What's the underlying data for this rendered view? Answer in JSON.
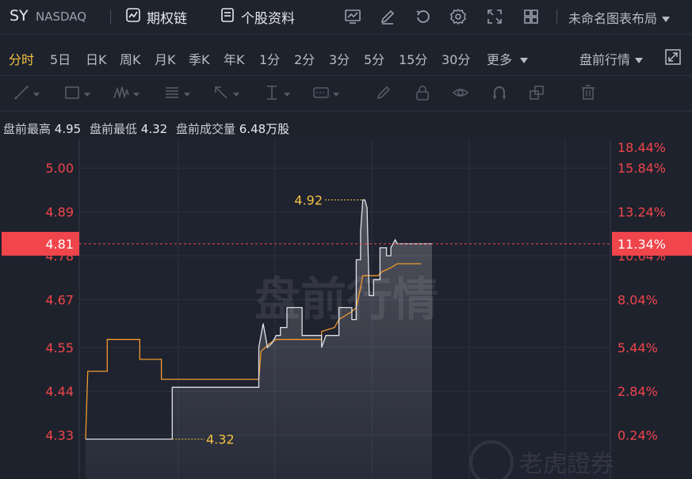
{
  "header": {
    "ticker": "SY",
    "exchange": "NASDAQ",
    "options_chain_label": "期权链",
    "profile_label": "个股资料",
    "layout_label": "未命名图表布局",
    "icons": [
      "chart-settings-icon",
      "edit-icon",
      "reset-icon",
      "gear-icon",
      "fullscreen-icon",
      "grid-layout-icon"
    ]
  },
  "timeframes": {
    "items": [
      "分时",
      "5日",
      "日K",
      "周K",
      "月K",
      "季K",
      "年K",
      "1分",
      "2分",
      "3分",
      "5分",
      "15分",
      "30分",
      "更多"
    ],
    "active": "分时",
    "session_label": "盘前行情"
  },
  "info": {
    "high_label": "盘前最高",
    "high_value": "4.95",
    "low_label": "盘前最低",
    "low_value": "4.32",
    "volume_label": "盘前成交量",
    "volume_value": "6.48万股"
  },
  "colors": {
    "background": "#1e222d",
    "red": "#f0454b",
    "price_line": "#e0e2e8",
    "avg_line": "#f29a2e",
    "annotation": "#f5c242"
  },
  "chart_data": {
    "type": "line",
    "y_ticks_left": [
      "5.00",
      "4.89",
      "4.78",
      "4.67",
      "4.55",
      "4.44",
      "4.33"
    ],
    "y_ticks_right": [
      "18.44%",
      "15.84%",
      "13.24%",
      "11.34%",
      "10.64%",
      "8.04%",
      "5.44%",
      "2.84%",
      "0.24%"
    ],
    "ylim": [
      4.22,
      5.06
    ],
    "current_price": "4.81",
    "current_pct": "11.34%",
    "max_label": "4.92",
    "min_label": "4.32",
    "watermark": "盘前行情",
    "brand_watermark": "老虎證券",
    "series": [
      {
        "name": "price",
        "points": [
          [
            0,
            4.32
          ],
          [
            40,
            4.32
          ],
          [
            40,
            4.45
          ],
          [
            65,
            4.45
          ],
          [
            65,
            4.45
          ],
          [
            80,
            4.45
          ],
          [
            80,
            4.55
          ],
          [
            82,
            4.61
          ],
          [
            84,
            4.55
          ],
          [
            86,
            4.56
          ],
          [
            88,
            4.58
          ],
          [
            90,
            4.58
          ],
          [
            90,
            4.6
          ],
          [
            93,
            4.6
          ],
          [
            93,
            4.65
          ],
          [
            100,
            4.65
          ],
          [
            100,
            4.58
          ],
          [
            109,
            4.58
          ],
          [
            109,
            4.55
          ],
          [
            111,
            4.58
          ],
          [
            117,
            4.58
          ],
          [
            117,
            4.65
          ],
          [
            123,
            4.65
          ],
          [
            123,
            4.62
          ],
          [
            125,
            4.62
          ],
          [
            125,
            4.77
          ],
          [
            127,
            4.77
          ],
          [
            127,
            4.84
          ],
          [
            128,
            4.92
          ],
          [
            129,
            4.92
          ],
          [
            130,
            4.9
          ],
          [
            131,
            4.68
          ],
          [
            133,
            4.68
          ],
          [
            133,
            4.72
          ],
          [
            136,
            4.72
          ],
          [
            136,
            4.8
          ],
          [
            139,
            4.8
          ],
          [
            139,
            4.78
          ],
          [
            141,
            4.78
          ],
          [
            141,
            4.8
          ],
          [
            143,
            4.82
          ],
          [
            144,
            4.81
          ],
          [
            160,
            4.81
          ]
        ]
      },
      {
        "name": "average",
        "points": [
          [
            0,
            4.32
          ],
          [
            1,
            4.49
          ],
          [
            10,
            4.49
          ],
          [
            10,
            4.57
          ],
          [
            25,
            4.57
          ],
          [
            25,
            4.52
          ],
          [
            35,
            4.52
          ],
          [
            35,
            4.47
          ],
          [
            80,
            4.47
          ],
          [
            81,
            4.54
          ],
          [
            83,
            4.55
          ],
          [
            85,
            4.56
          ],
          [
            88,
            4.57
          ],
          [
            109,
            4.57
          ],
          [
            109,
            4.59
          ],
          [
            115,
            4.6
          ],
          [
            117,
            4.62
          ],
          [
            123,
            4.64
          ],
          [
            125,
            4.65
          ],
          [
            127,
            4.7
          ],
          [
            128,
            4.73
          ],
          [
            135,
            4.73
          ],
          [
            137,
            4.74
          ],
          [
            141,
            4.75
          ],
          [
            144,
            4.76
          ],
          [
            155,
            4.76
          ]
        ]
      }
    ]
  }
}
